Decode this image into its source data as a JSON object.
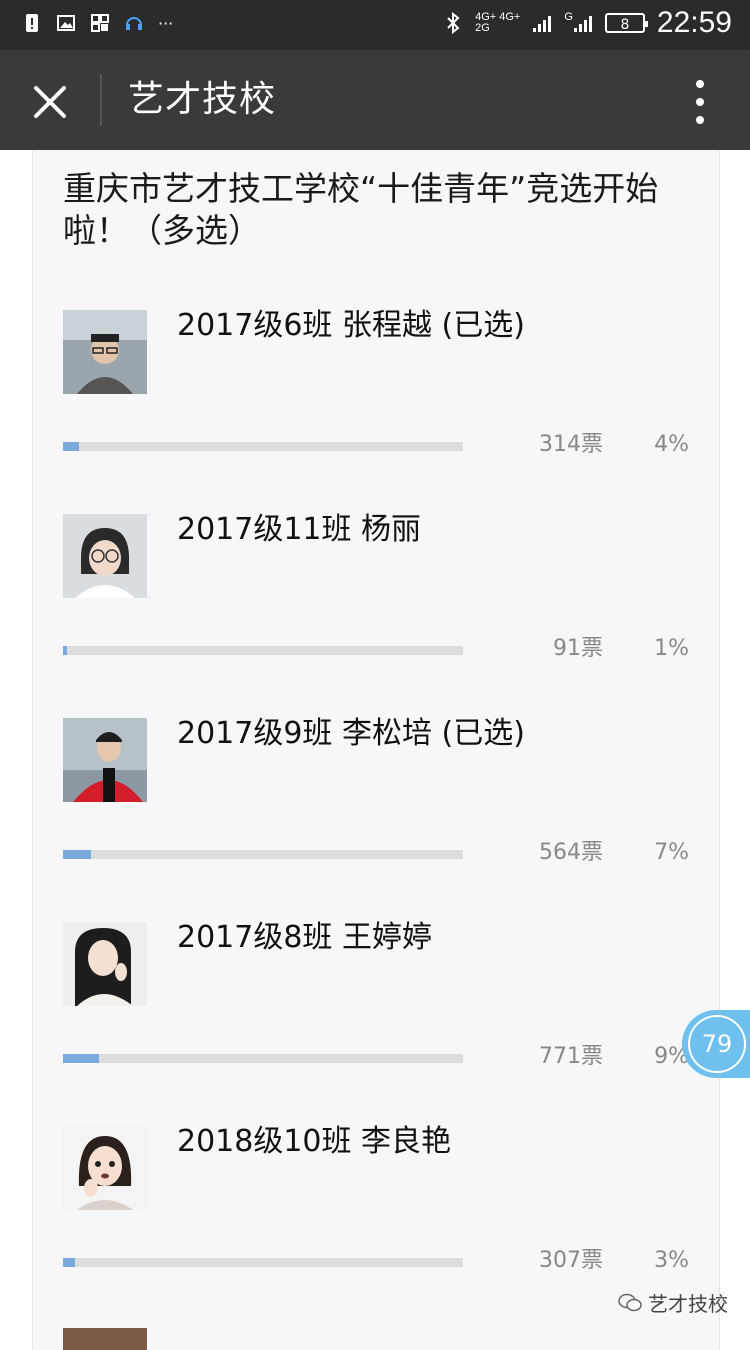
{
  "status_bar": {
    "time": "22:59",
    "battery": "8",
    "network_top": "4G+ 4G+",
    "network_bottom": "2G",
    "signal2_label": "G"
  },
  "nav": {
    "title": "艺才技校"
  },
  "vote": {
    "title": "重庆市艺才技工学校“十佳青年”竞选开始啦！（多选）",
    "candidates": [
      {
        "name": "2017级6班 张程越 (已选)",
        "votes": "314票",
        "percent": "4%",
        "share": 0.04
      },
      {
        "name": "2017级11班 杨丽",
        "votes": "91票",
        "percent": "1%",
        "share": 0.01
      },
      {
        "name": "2017级9班 李松培 (已选)",
        "votes": "564票",
        "percent": "7%",
        "share": 0.07
      },
      {
        "name": "2017级8班 王婷婷",
        "votes": "771票",
        "percent": "9%",
        "share": 0.09
      },
      {
        "name": "2018级10班 李良艳",
        "votes": "307票",
        "percent": "3%",
        "share": 0.03
      }
    ]
  },
  "float_badge": {
    "count": "79"
  },
  "watermark": {
    "text": "艺才技校"
  },
  "colors": {
    "accent": "#7aa9db",
    "badge": "#6fc0ee"
  }
}
